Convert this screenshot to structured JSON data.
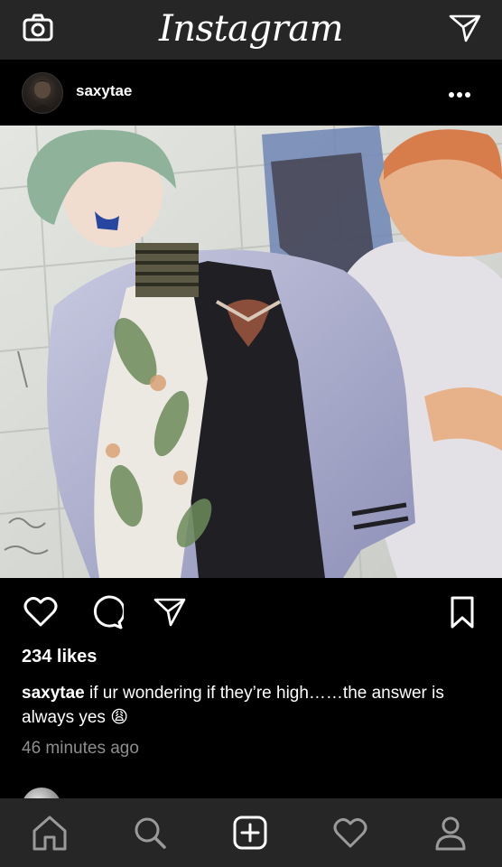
{
  "app": {
    "logo_text": "Instagram",
    "accent_color": "#ffffff",
    "bar_color": "#262626",
    "background_color": "#000000"
  },
  "top_nav": {
    "left_icon": "camera-icon",
    "right_icon": "direct-message-icon"
  },
  "post": {
    "username": "saxytae",
    "more_icon": "more-options-icon",
    "actions": {
      "like_icon": "heart-icon",
      "comment_icon": "comment-icon",
      "share_icon": "share-icon",
      "save_icon": "bookmark-icon"
    },
    "likes_text": "234 likes",
    "caption": {
      "username": "saxytae",
      "text": "if ur wondering if they’re high……the answer is always yes 😩"
    },
    "timestamp": "46 minutes ago"
  },
  "tab_bar": {
    "items": [
      {
        "name": "home",
        "icon": "home-icon"
      },
      {
        "name": "search",
        "icon": "search-icon"
      },
      {
        "name": "new-post",
        "icon": "add-post-icon"
      },
      {
        "name": "activity",
        "icon": "heart-icon"
      },
      {
        "name": "profile",
        "icon": "profile-icon"
      }
    ],
    "inactive_color": "#9a9a9a"
  }
}
